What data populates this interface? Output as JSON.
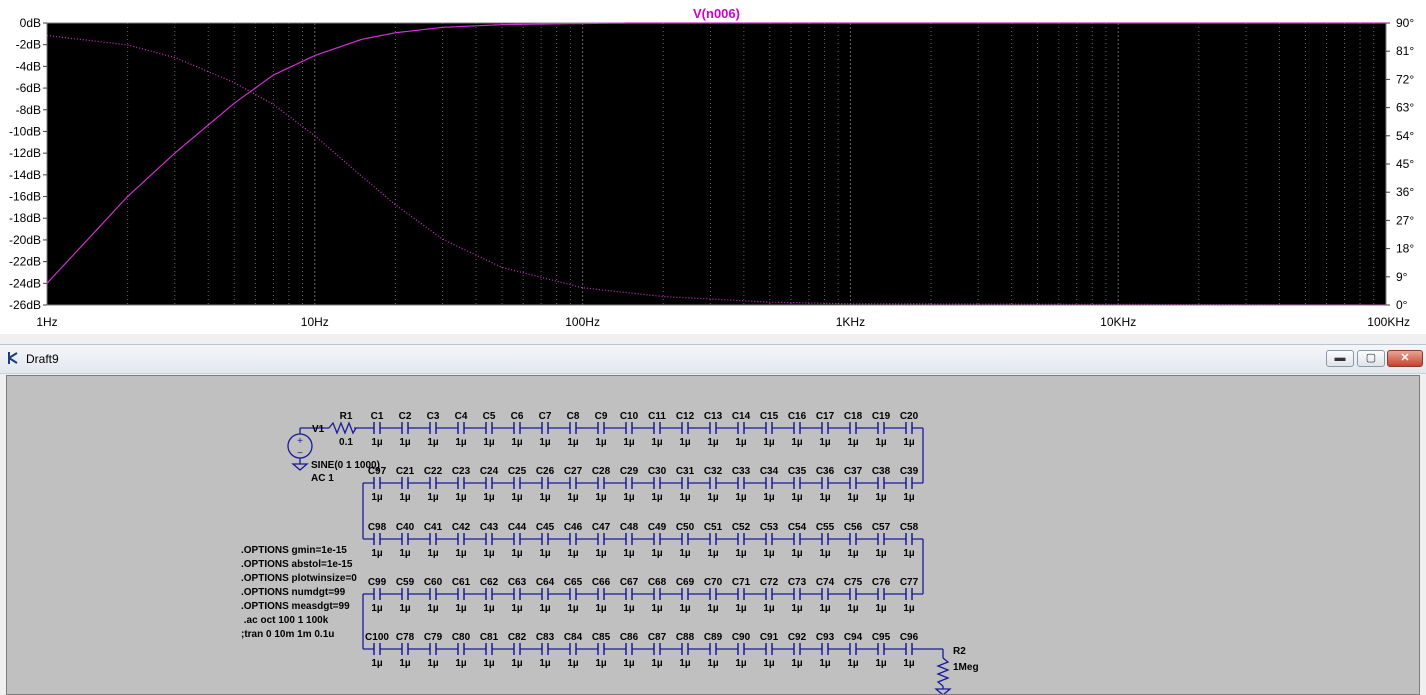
{
  "plot": {
    "trace_label": "V(n006)",
    "colors": {
      "background": "#000000",
      "grid": "#666666",
      "trace": "#d030d0",
      "label": "#d000d0"
    },
    "y_left_ticks": [
      "0dB",
      "-2dB",
      "-4dB",
      "-6dB",
      "-8dB",
      "-10dB",
      "-12dB",
      "-14dB",
      "-16dB",
      "-18dB",
      "-20dB",
      "-22dB",
      "-24dB",
      "-26dB"
    ],
    "y_right_ticks": [
      "90°",
      "81°",
      "72°",
      "63°",
      "54°",
      "45°",
      "36°",
      "27°",
      "18°",
      "9°",
      "0°"
    ],
    "x_ticks": [
      "1Hz",
      "10Hz",
      "100Hz",
      "1KHz",
      "10KHz",
      "100KHz"
    ]
  },
  "chart_data": {
    "type": "line",
    "title": "V(n006)",
    "x_scale": "log",
    "xlim": [
      1,
      100000
    ],
    "ylim_left": [
      -26,
      0
    ],
    "ylim_right": [
      0,
      90
    ],
    "grid": true,
    "series": [
      {
        "name": "V(n006)",
        "axis": "left",
        "style": "solid",
        "x": [
          1,
          2,
          3,
          5,
          7,
          10,
          15,
          20,
          30,
          50,
          100,
          150,
          1000,
          100000
        ],
        "values": [
          -24,
          -16,
          -12,
          -7.4,
          -4.8,
          -3.0,
          -1.5,
          -0.9,
          -0.4,
          -0.15,
          -0.05,
          0,
          0,
          0
        ]
      },
      {
        "name": "V(n006)",
        "axis": "right",
        "style": "dotted",
        "x": [
          1,
          2,
          3,
          5,
          7,
          10,
          15,
          20,
          30,
          50,
          100,
          200,
          500,
          1000,
          100000
        ],
        "values": [
          86,
          83,
          79,
          71,
          64,
          54,
          41,
          32,
          21,
          12,
          5.5,
          2.7,
          0.9,
          0.4,
          0
        ]
      }
    ]
  },
  "window": {
    "title": "Draft9",
    "minimize": "▬",
    "maximize": "▢",
    "close": "✕"
  },
  "schematic": {
    "source": {
      "name": "V1",
      "value1": "SINE(0 1 1000)",
      "value2": "AC 1"
    },
    "r1": {
      "name": "R1",
      "value": "0.1"
    },
    "r2": {
      "name": "R2",
      "value": "1Meg"
    },
    "cap_value": "1µ",
    "rows": [
      [
        "C1",
        "C2",
        "C3",
        "C4",
        "C5",
        "C6",
        "C7",
        "C8",
        "C9",
        "C10",
        "C11",
        "C12",
        "C13",
        "C14",
        "C15",
        "C16",
        "C17",
        "C18",
        "C19",
        "C20"
      ],
      [
        "C97",
        "C21",
        "C22",
        "C23",
        "C24",
        "C25",
        "C26",
        "C27",
        "C28",
        "C29",
        "C30",
        "C31",
        "C32",
        "C33",
        "C34",
        "C35",
        "C36",
        "C37",
        "C38",
        "C39"
      ],
      [
        "C98",
        "C40",
        "C41",
        "C42",
        "C43",
        "C44",
        "C45",
        "C46",
        "C47",
        "C48",
        "C49",
        "C50",
        "C51",
        "C52",
        "C53",
        "C54",
        "C55",
        "C56",
        "C57",
        "C58"
      ],
      [
        "C99",
        "C59",
        "C60",
        "C61",
        "C62",
        "C63",
        "C64",
        "C65",
        "C66",
        "C67",
        "C68",
        "C69",
        "C70",
        "C71",
        "C72",
        "C73",
        "C74",
        "C75",
        "C76",
        "C77"
      ],
      [
        "C100",
        "C78",
        "C79",
        "C80",
        "C81",
        "C82",
        "C83",
        "C84",
        "C85",
        "C86",
        "C87",
        "C88",
        "C89",
        "C90",
        "C91",
        "C92",
        "C93",
        "C94",
        "C95",
        "C96"
      ]
    ],
    "directives": [
      ".OPTIONS gmin=1e-15",
      ".OPTIONS abstol=1e-15",
      ".OPTIONS plotwinsize=0",
      ".OPTIONS numdgt=99",
      ".OPTIONS measdgt=99",
      " .ac oct 100 1 100k",
      ";tran 0 10m 1m 0.1u"
    ]
  }
}
